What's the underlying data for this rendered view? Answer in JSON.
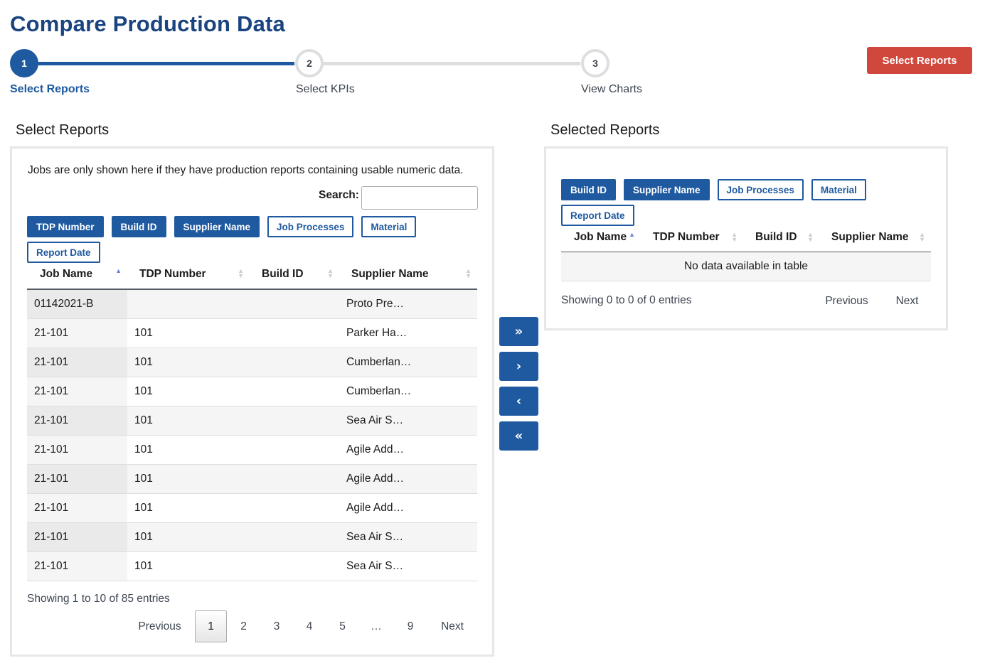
{
  "page": {
    "title": "Compare Production Data"
  },
  "stepper": {
    "steps": [
      {
        "number": "1",
        "label": "Select Reports"
      },
      {
        "number": "2",
        "label": "Select KPIs"
      },
      {
        "number": "3",
        "label": "View Charts"
      }
    ],
    "action_label": "Select Reports"
  },
  "left": {
    "heading": "Select Reports",
    "note": "Jobs are only shown here if they have production reports containing usable numeric data.",
    "search_label": "Search:",
    "search_value": "",
    "column_toggles": [
      {
        "label": "TDP Number",
        "active": true
      },
      {
        "label": "Build ID",
        "active": true
      },
      {
        "label": "Supplier Name",
        "active": true
      },
      {
        "label": "Job Processes",
        "active": false
      },
      {
        "label": "Material",
        "active": false
      },
      {
        "label": "Report Date",
        "active": false
      }
    ],
    "columns": [
      "Job Name",
      "TDP Number",
      "Build ID",
      "Supplier Name"
    ],
    "rows": [
      [
        "01142021-B",
        "",
        "",
        "Proto Pre…"
      ],
      [
        "21-101",
        "101",
        "",
        "Parker Ha…"
      ],
      [
        "21-101",
        "101",
        "",
        "Cumberlan…"
      ],
      [
        "21-101",
        "101",
        "",
        "Cumberlan…"
      ],
      [
        "21-101",
        "101",
        "",
        "Sea Air S…"
      ],
      [
        "21-101",
        "101",
        "",
        "Agile Add…"
      ],
      [
        "21-101",
        "101",
        "",
        "Agile Add…"
      ],
      [
        "21-101",
        "101",
        "",
        "Agile Add…"
      ],
      [
        "21-101",
        "101",
        "",
        "Sea Air S…"
      ],
      [
        "21-101",
        "101",
        "",
        "Sea Air S…"
      ]
    ],
    "info": "Showing 1 to 10 of 85 entries",
    "pagination": {
      "previous": "Previous",
      "pages": [
        "1",
        "2",
        "3",
        "4",
        "5",
        "…",
        "9"
      ],
      "current": "1",
      "next": "Next"
    }
  },
  "move_buttons": {
    "add_all": "»",
    "add": "›",
    "remove": "‹",
    "remove_all": "«"
  },
  "right": {
    "heading": "Selected Reports",
    "column_toggles": [
      {
        "label": "Build ID",
        "active": true
      },
      {
        "label": "Supplier Name",
        "active": true
      },
      {
        "label": "Job Processes",
        "active": false
      },
      {
        "label": "Material",
        "active": false
      },
      {
        "label": "Report Date",
        "active": false
      }
    ],
    "columns": [
      "Job Name",
      "TDP Number",
      "Build ID",
      "Supplier Name"
    ],
    "empty_text": "No data available in table",
    "info": "Showing 0 to 0 of 0 entries",
    "pagination": {
      "previous": "Previous",
      "next": "Next"
    }
  },
  "colors": {
    "brand": "#1a4480",
    "primary": "#1f5aa0",
    "danger": "#d0473b",
    "step_inactive": "#dcdee0"
  }
}
